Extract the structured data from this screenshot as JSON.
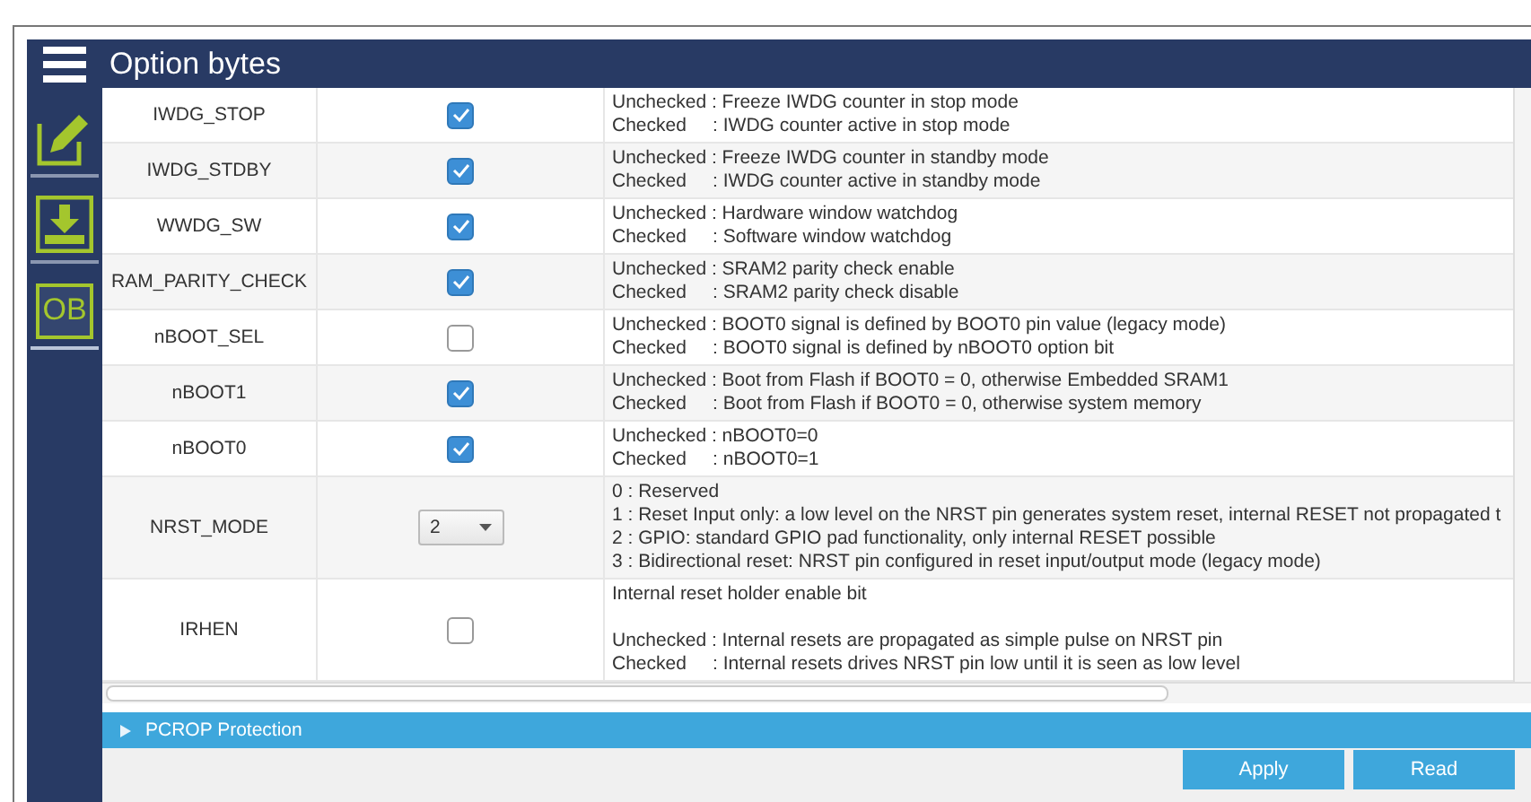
{
  "window": {
    "title": "Option bytes"
  },
  "sidebar": {
    "items": [
      {
        "kind": "edit",
        "selected": false
      },
      {
        "kind": "download",
        "selected": false
      },
      {
        "kind": "text",
        "label": "OB",
        "selected": true
      }
    ]
  },
  "table": {
    "rows": [
      {
        "name": "IWDG_STOP",
        "kind": "checkbox",
        "checked": true,
        "lines": [
          "Unchecked : Freeze IWDG counter in stop mode",
          "Checked     : IWDG counter active in stop mode"
        ]
      },
      {
        "name": "IWDG_STDBY",
        "kind": "checkbox",
        "checked": true,
        "lines": [
          "Unchecked : Freeze IWDG counter in standby mode",
          "Checked     : IWDG counter active in standby mode"
        ]
      },
      {
        "name": "WWDG_SW",
        "kind": "checkbox",
        "checked": true,
        "lines": [
          "Unchecked : Hardware window watchdog",
          "Checked     : Software window watchdog"
        ]
      },
      {
        "name": "RAM_PARITY_CHECK",
        "kind": "checkbox",
        "checked": true,
        "lines": [
          "Unchecked : SRAM2 parity check enable",
          "Checked     : SRAM2 parity check disable"
        ]
      },
      {
        "name": "nBOOT_SEL",
        "kind": "checkbox",
        "checked": false,
        "lines": [
          "Unchecked : BOOT0 signal is defined by BOOT0 pin value (legacy mode)",
          "Checked     : BOOT0 signal is defined by nBOOT0 option bit"
        ]
      },
      {
        "name": "nBOOT1",
        "kind": "checkbox",
        "checked": true,
        "lines": [
          "Unchecked : Boot from Flash if BOOT0 = 0, otherwise Embedded SRAM1",
          "Checked     : Boot from Flash if BOOT0 = 0, otherwise system memory"
        ]
      },
      {
        "name": "nBOOT0",
        "kind": "checkbox",
        "checked": true,
        "lines": [
          "Unchecked : nBOOT0=0",
          "Checked     : nBOOT0=1"
        ]
      },
      {
        "name": "NRST_MODE",
        "kind": "select",
        "value": "2",
        "lines": [
          "0 : Reserved",
          "1 : Reset Input only: a low level on the NRST pin generates system reset, internal RESET not propagated t",
          "2 : GPIO: standard GPIO pad functionality, only internal RESET possible",
          "3 : Bidirectional reset: NRST pin configured in reset input/output mode (legacy mode)"
        ]
      },
      {
        "name": "IRHEN",
        "kind": "checkbox",
        "checked": false,
        "note": "Internal reset holder enable bit",
        "lines": [
          "Unchecked : Internal resets are propagated as simple pulse on NRST pin",
          "Checked     : Internal resets drives NRST pin low until it is seen as low level"
        ]
      }
    ]
  },
  "section": {
    "title": "PCROP Protection",
    "expanded": false
  },
  "buttons": [
    "Apply",
    "Read"
  ]
}
